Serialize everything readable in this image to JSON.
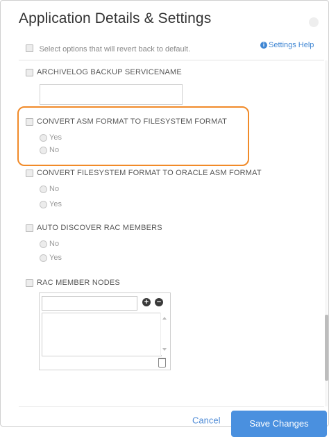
{
  "dialog": {
    "title": "Application Details & Settings"
  },
  "top": {
    "revert_label": "Select options that will revert back to default.",
    "help_link": "Settings Help"
  },
  "options": {
    "archivelog_label": "ARCHIVELOG BACKUP SERVICENAME",
    "convert_asm_label": "CONVERT ASM FORMAT TO FILESYSTEM FORMAT",
    "convert_asm_yes": "Yes",
    "convert_asm_no": "No",
    "convert_fs_label": "CONVERT FILESYSTEM FORMAT TO ORACLE ASM FORMAT",
    "convert_fs_no": "No",
    "convert_fs_yes": "Yes",
    "auto_discover_label": "AUTO DISCOVER RAC MEMBERS",
    "auto_discover_no": "No",
    "auto_discover_yes": "Yes",
    "rac_nodes_label": "RAC MEMBER NODES"
  },
  "footer": {
    "cancel": "Cancel",
    "save": "Save Changes"
  },
  "colors": {
    "accent": "#4a90df",
    "highlight": "#f18a28"
  }
}
